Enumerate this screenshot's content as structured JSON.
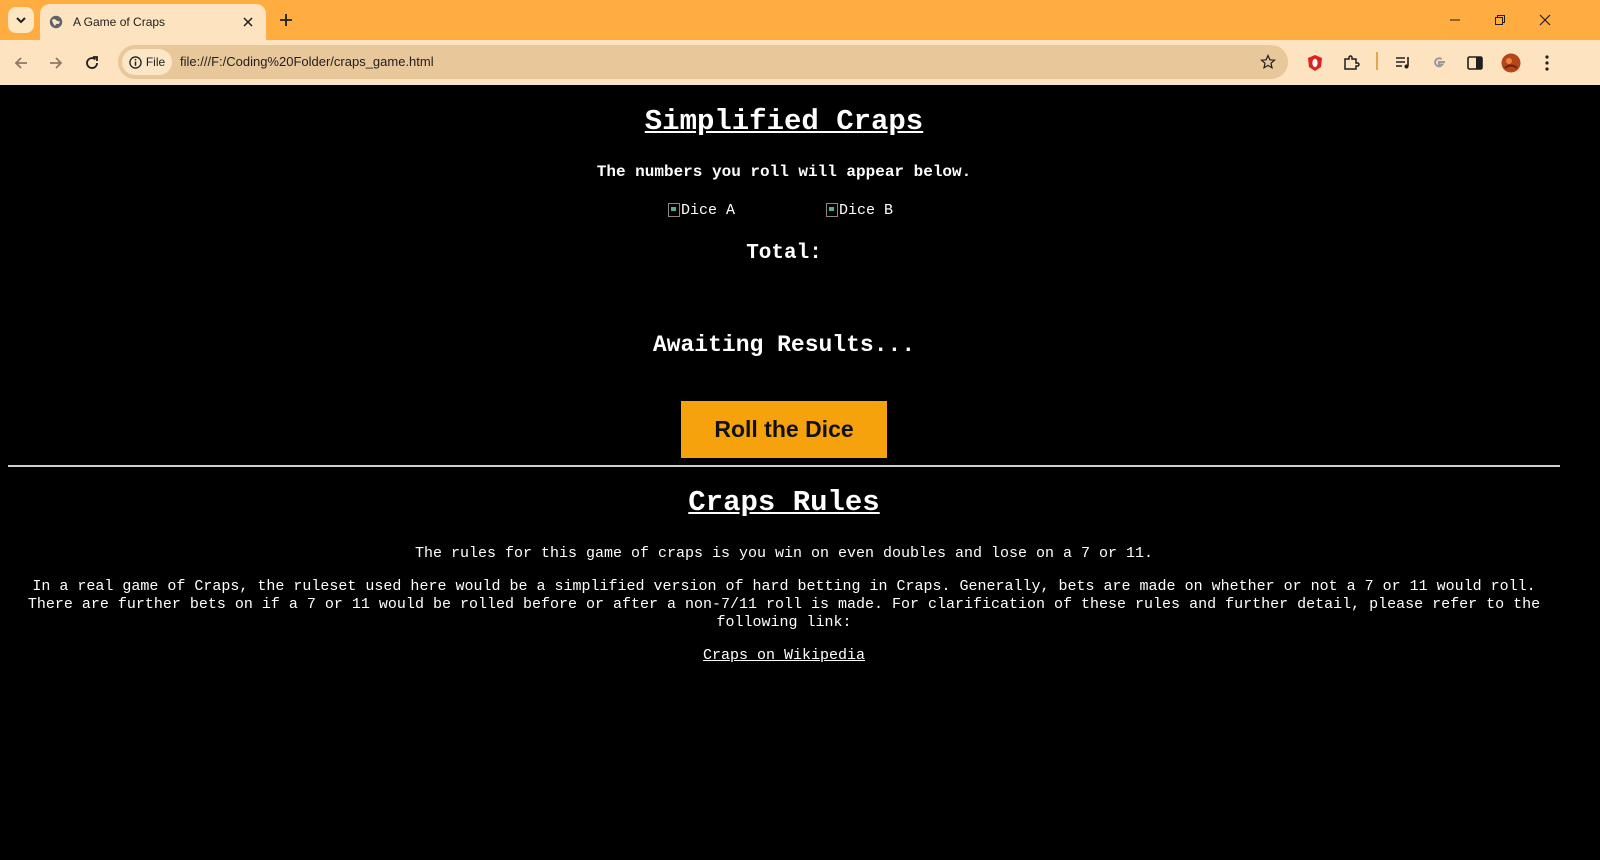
{
  "browser": {
    "tab_title": "A Game of Craps",
    "site_chip_label": "File",
    "url": "file:///F:/Coding%20Folder/craps_game.html",
    "colors": {
      "titlebar": "#ffac40",
      "toolbar": "#fde3bf",
      "omnibox": "#e8c79b"
    }
  },
  "game": {
    "title": "Simplified Craps",
    "subtitle": "The numbers you roll will appear below.",
    "dice_a_alt": "Dice A",
    "dice_b_alt": "Dice B",
    "total_label": "Total:",
    "result_text": "Awaiting Results...",
    "roll_button_label": "Roll the Dice",
    "roll_button_color": "#f5a20c"
  },
  "rules": {
    "title": "Craps Rules",
    "summary": "The rules for this game of craps is you win on even doubles and lose on a 7 or 11.",
    "detail": "In a real game of Craps, the ruleset used here would be a simplified version of hard betting in Craps. Generally, bets are made on whether or not a 7 or 11 would roll. There are further bets on if a 7 or 11 would be rolled before or after a non-7/11 roll is made. For clarification of these rules and further detail, please refer to the following link:",
    "link_text": "Craps on Wikipedia"
  }
}
